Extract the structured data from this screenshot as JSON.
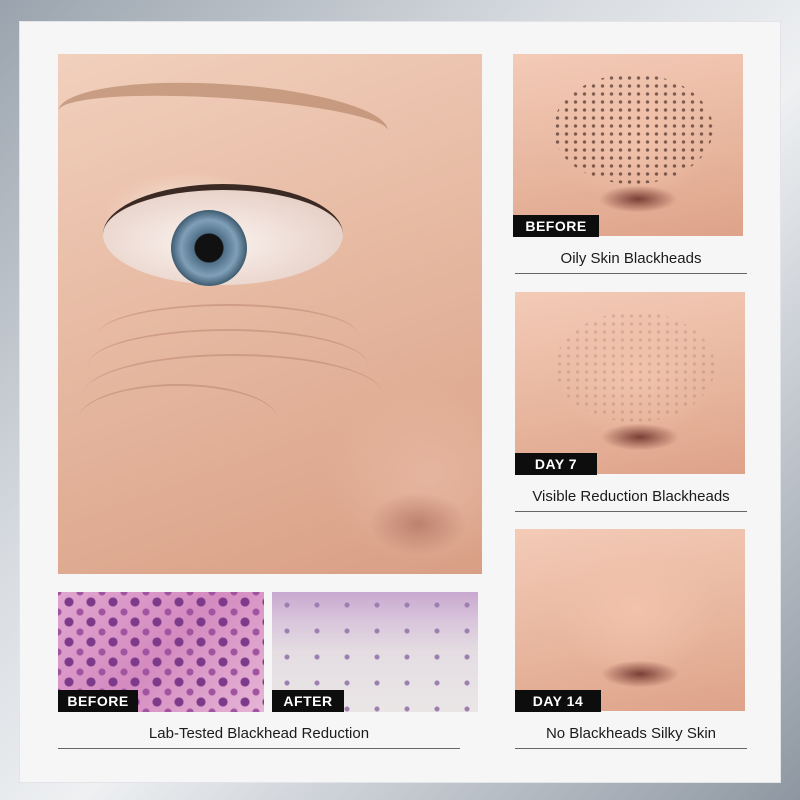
{
  "face_panel": {},
  "nose_panels": [
    {
      "tag": "BEFORE",
      "caption": "Oily Skin Blackheads"
    },
    {
      "tag": "DAY 7",
      "caption": "Visible Reduction Blackheads"
    },
    {
      "tag": "DAY 14",
      "caption": "No Blackheads Silky Skin"
    }
  ],
  "lab_panels": {
    "before_tag": "BEFORE",
    "after_tag": "AFTER",
    "caption": "Lab-Tested Blackhead Reduction"
  },
  "colors": {
    "tag_background": "#0d0d0d",
    "tag_text": "#ffffff",
    "panel_background": "#f6f6f6"
  }
}
